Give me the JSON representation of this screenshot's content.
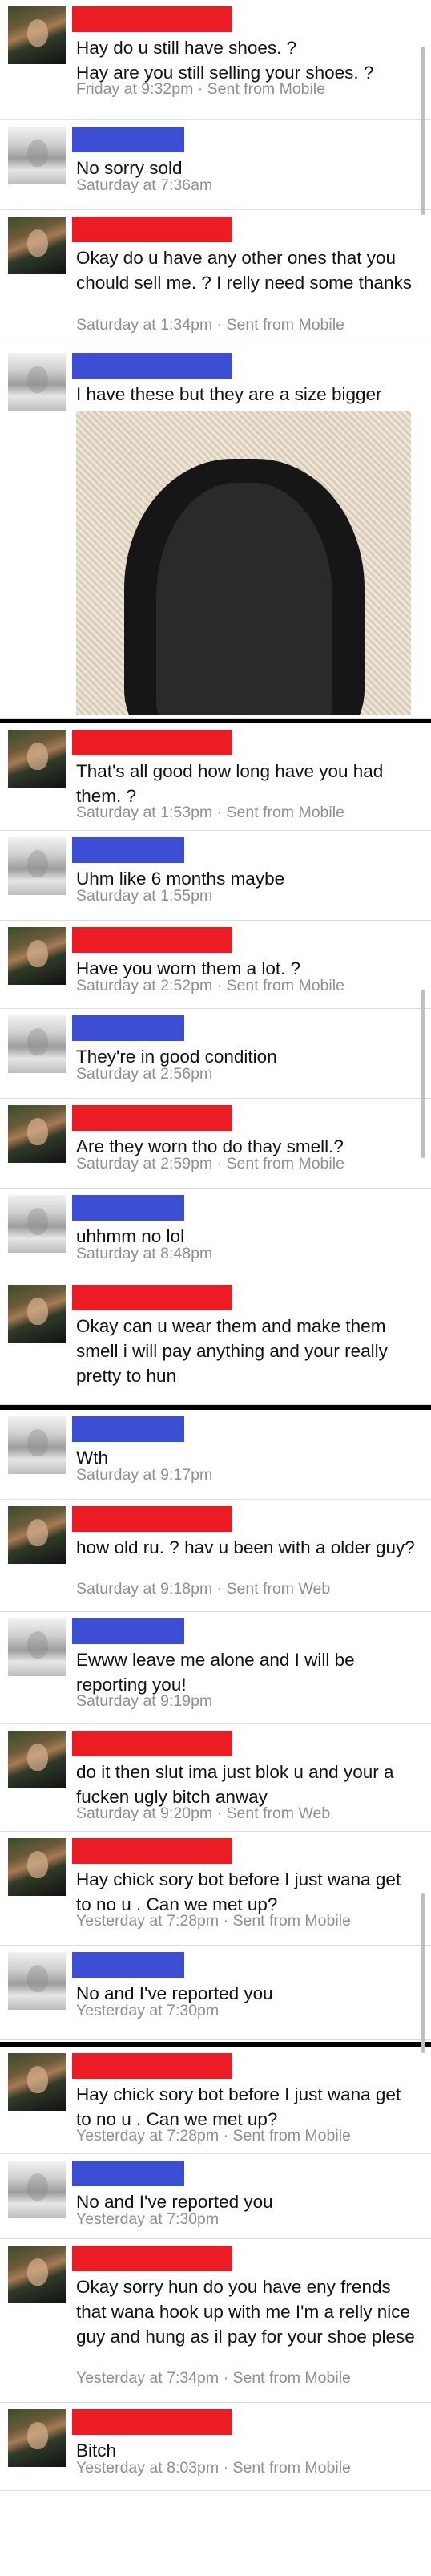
{
  "messages": [
    {
      "side": "red",
      "text": "Hay do u still have shoes. ?\nHay are you still selling your shoes. ?",
      "time": "Friday at 9:32pm",
      "source": "Sent from Mobile"
    },
    {
      "side": "blue",
      "text": "No sorry sold",
      "time": "Saturday at 7:36am",
      "source": ""
    },
    {
      "side": "red",
      "text": "Okay do u have any other ones that you chould sell me. ? I relly need some thanks",
      "time": "Saturday at 1:34pm",
      "source": "Sent from Mobile"
    },
    {
      "side": "blue",
      "text": "I have these but they are a size bigger",
      "time": "",
      "source": ""
    },
    {
      "side": "red",
      "text": "That's all good how long have you had them. ?",
      "time": "Saturday at 1:53pm",
      "source": "Sent from Mobile"
    },
    {
      "side": "blue",
      "text": "Uhm like 6 months maybe",
      "time": "Saturday at 1:55pm",
      "source": ""
    },
    {
      "side": "red",
      "text": "Have you worn them a lot. ?",
      "time": "Saturday at 2:52pm",
      "source": "Sent from Mobile"
    },
    {
      "side": "blue",
      "text": "They're in good condition",
      "time": "Saturday at 2:56pm",
      "source": ""
    },
    {
      "side": "red",
      "text": "Are they worn tho do thay smell.?",
      "time": "Saturday at 2:59pm",
      "source": "Sent from Mobile"
    },
    {
      "side": "blue",
      "text": "uhhmm no lol",
      "time": "Saturday at 8:48pm",
      "source": ""
    },
    {
      "side": "red",
      "text": "Okay can u wear them and make them smell i will pay anything and your really pretty to hun",
      "time": "",
      "source": ""
    },
    {
      "side": "blue",
      "text": "Wth",
      "time": "Saturday at 9:17pm",
      "source": ""
    },
    {
      "side": "red",
      "text": "how old ru. ? hav u been with a older guy?",
      "time": "Saturday at 9:18pm",
      "source": "Sent from Web"
    },
    {
      "side": "blue",
      "text": "Ewww leave me alone and I will be reporting you!",
      "time": "Saturday at 9:19pm",
      "source": ""
    },
    {
      "side": "red",
      "text": "do it then slut ima just blok u and your a fucken ugly bitch anway",
      "time": "Saturday at 9:20pm",
      "source": "Sent from Web"
    },
    {
      "side": "red",
      "text": "Hay chick sory bot before I just wana get to no u . Can we met up?",
      "time": "Yesterday at 7:28pm",
      "source": "Sent from Mobile"
    },
    {
      "side": "blue",
      "text": "No and I've reported you",
      "time": "Yesterday at 7:30pm",
      "source": ""
    },
    {
      "side": "red",
      "text": "Hay chick sory bot before I just wana get to no u . Can we met up?",
      "time": "Yesterday at 7:28pm",
      "source": "Sent from Mobile"
    },
    {
      "side": "blue",
      "text": "No and I've reported you",
      "time": "Yesterday at 7:30pm",
      "source": ""
    },
    {
      "side": "red",
      "text": "Okay sorry hun do you have eny frends that wana hook up with me I'm a relly nice guy and hung as il pay for your shoe plese",
      "time": "Yesterday at 7:34pm",
      "source": "Sent from Mobile"
    },
    {
      "side": "red",
      "text": "Bitch",
      "time": "Yesterday at 8:03pm",
      "source": "Sent from Mobile"
    }
  ],
  "separator": " · "
}
